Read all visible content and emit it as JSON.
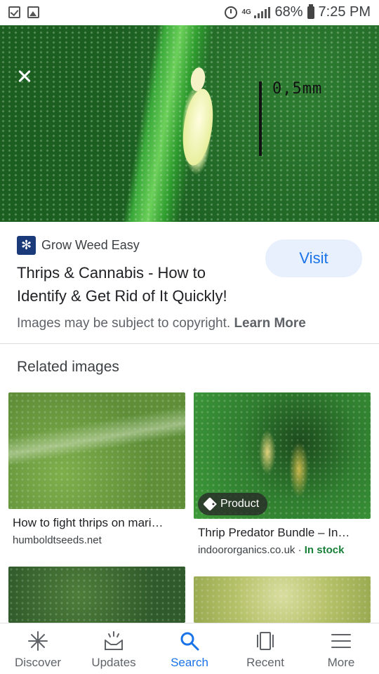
{
  "status_bar": {
    "battery": "68%",
    "time": "7:25 PM",
    "network": "4G"
  },
  "hero": {
    "scale_label": "0,5mm"
  },
  "source": {
    "name": "Grow Weed Easy",
    "icon": "cannabis-leaf-icon"
  },
  "result": {
    "title": "Thrips & Cannabis - How to Identify & Get Rid of It Quickly!",
    "visit_label": "Visit",
    "copyright_text": "Images may be subject to copyright.",
    "learn_more": "Learn More"
  },
  "related": {
    "heading": "Related images",
    "items": [
      {
        "title": "How to fight thrips on mari…",
        "domain": "humboldtseeds.net"
      },
      {
        "title": "Thrip Predator Bundle – In…",
        "domain": "indoororganics.co.uk ·",
        "stock": "In stock",
        "badge": "Product"
      },
      {},
      {}
    ]
  },
  "bottom_nav": {
    "items": [
      {
        "label": "Discover",
        "icon": "asterisk-icon"
      },
      {
        "label": "Updates",
        "icon": "inbox-updates-icon"
      },
      {
        "label": "Search",
        "icon": "search-icon",
        "active": true
      },
      {
        "label": "Recent",
        "icon": "recent-tabs-icon"
      },
      {
        "label": "More",
        "icon": "menu-icon"
      }
    ]
  },
  "colors": {
    "accent": "#1a73e8",
    "visit_bg": "#e8f0fe",
    "in_stock": "#188038"
  }
}
